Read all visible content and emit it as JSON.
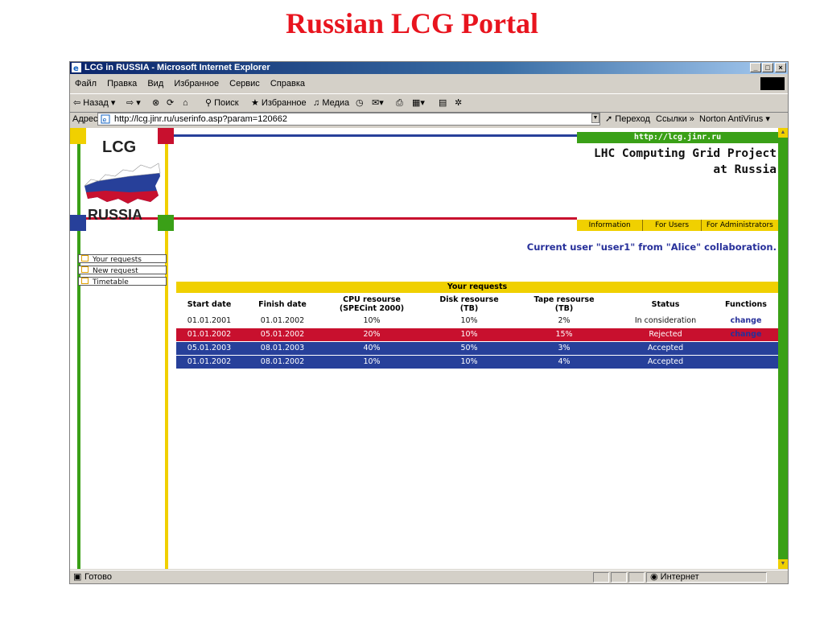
{
  "slide_title": "Russian LCG Portal",
  "window": {
    "title": "LCG in RUSSIA - Microsoft Internet Explorer"
  },
  "menu": [
    "Файл",
    "Правка",
    "Вид",
    "Избранное",
    "Сервис",
    "Справка"
  ],
  "toolbar": {
    "back": "Назад",
    "search": "Поиск",
    "favorites": "Избранное",
    "media": "Медиа"
  },
  "address": {
    "label": "Адрес:",
    "url": "http://lcg.jinr.ru/userinfo.asp?param=120662",
    "go": "Переход",
    "links": "Ссылки",
    "norton": "Norton AntiVirus"
  },
  "site": {
    "logo_top": "LCG",
    "logo_bottom": "RUSSIA",
    "url": "http://lcg.jinr.ru",
    "project_line1": "LHC Computing Grid Project",
    "project_line2": "at Russia",
    "tabs": [
      "Information",
      "For Users",
      "For Administrators"
    ],
    "current_user": "Current user \"user1\" from \"Alice\" collaboration.",
    "sidebar": [
      "Your requests",
      "New request",
      "Timetable"
    ]
  },
  "requests": {
    "title": "Your requests",
    "columns": [
      "Start date",
      "Finish date",
      "CPU resourse\n(SPECint 2000)",
      "Disk resourse\n(TB)",
      "Tape resourse\n(TB)",
      "Status",
      "Functions"
    ],
    "rows": [
      {
        "start": "01.01.2001",
        "finish": "01.01.2002",
        "cpu": "10%",
        "disk": "10%",
        "tape": "2%",
        "status": "In consideration",
        "func": "change",
        "bg": "#ffffff",
        "fg": "#111111"
      },
      {
        "start": "01.01.2002",
        "finish": "05.01.2002",
        "cpu": "20%",
        "disk": "10%",
        "tape": "15%",
        "status": "Rejected",
        "func": "change",
        "bg": "#c8102e",
        "fg": "#ffffff"
      },
      {
        "start": "05.01.2003",
        "finish": "08.01.2003",
        "cpu": "40%",
        "disk": "50%",
        "tape": "3%",
        "status": "Accepted",
        "func": "",
        "bg": "#27409a",
        "fg": "#ffffff"
      },
      {
        "start": "01.01.2002",
        "finish": "08.01.2002",
        "cpu": "10%",
        "disk": "10%",
        "tape": "4%",
        "status": "Accepted",
        "func": "",
        "bg": "#27409a",
        "fg": "#ffffff"
      }
    ]
  },
  "status": {
    "ready": "Готово",
    "zone": "Интернет"
  },
  "colors": {
    "yellow": "#f0d000",
    "green": "#3aa017",
    "red": "#c8102e",
    "blue": "#27409a",
    "change_link": "#27309a"
  }
}
